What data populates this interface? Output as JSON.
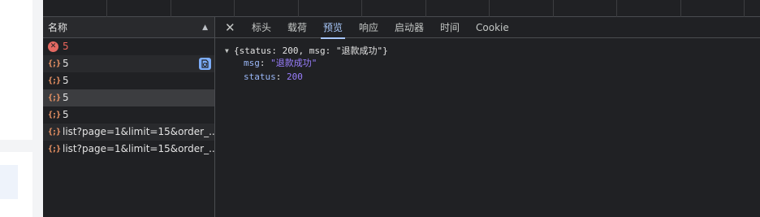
{
  "request_list": {
    "header": "名称",
    "sort_glyph": "▲",
    "rows": [
      {
        "name": "5",
        "icon": "error-icon"
      },
      {
        "name": "5",
        "icon": "json-icon"
      },
      {
        "name": "5",
        "icon": "json-icon"
      },
      {
        "name": "5",
        "icon": "json-icon"
      },
      {
        "name": "5",
        "icon": "json-icon"
      },
      {
        "name": "list?page=1&limit=15&order_...",
        "icon": "json-icon"
      },
      {
        "name": "list?page=1&limit=15&order_...",
        "icon": "json-icon"
      }
    ],
    "json_glyph": "{;}",
    "error_glyph": "✕"
  },
  "detail": {
    "close_glyph": "✕",
    "tabs": [
      "标头",
      "载荷",
      "预览",
      "响应",
      "启动器",
      "时间",
      "Cookie"
    ],
    "active_tab": "预览",
    "preview": {
      "summary": "{status: 200, msg: \"退款成功\"}",
      "fields": [
        {
          "key": "msg",
          "value": "\"退款成功\""
        },
        {
          "key": "status",
          "value": "200"
        }
      ]
    }
  },
  "colors": {
    "panel_bg": "#202124",
    "accent": "#a8c7fa",
    "error": "#e46962",
    "json_icon": "#f29766"
  }
}
